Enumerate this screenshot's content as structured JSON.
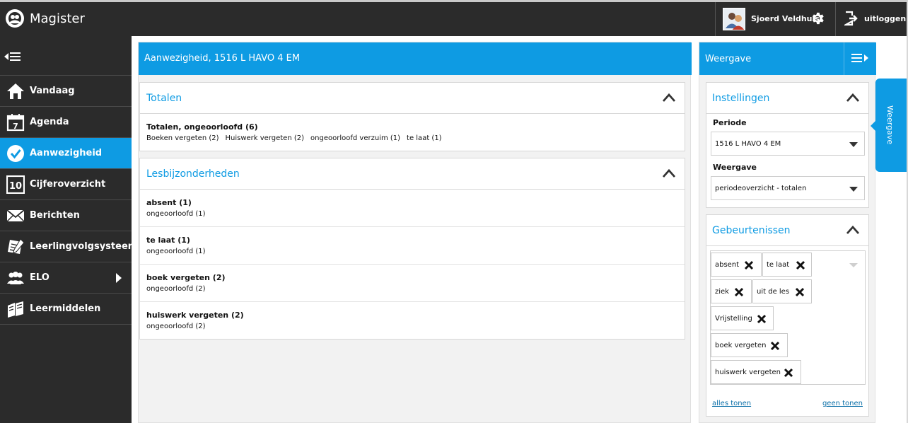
{
  "app": {
    "name": "Magister"
  },
  "user": {
    "name": "Sjoerd Veldhuis",
    "logout_label": "uitloggen"
  },
  "sidebar": {
    "items": [
      {
        "label": "Vandaag",
        "icon": "home-icon"
      },
      {
        "label": "Agenda",
        "icon": "calendar-icon"
      },
      {
        "label": "Aanwezigheid",
        "icon": "check-circle-icon",
        "active": true
      },
      {
        "label": "Cijferoverzicht",
        "icon": "grade-10-icon"
      },
      {
        "label": "Berichten",
        "icon": "envelope-icon"
      },
      {
        "label": "Leerlingvolgsysteem",
        "icon": "notes-icon"
      },
      {
        "label": "ELO",
        "icon": "people-icon",
        "has_submenu": true
      },
      {
        "label": "Leermiddelen",
        "icon": "books-icon"
      }
    ]
  },
  "main": {
    "title": "Aanwezigheid, 1516 L HAVO 4 EM",
    "totals": {
      "title": "Totalen",
      "heading": "Totalen, ongeoorloofd (6)",
      "items": [
        "Boeken vergeten (2)",
        "Huiswerk vergeten (2)",
        "ongeoorloofd verzuim (1)",
        "te laat (1)"
      ]
    },
    "details": {
      "title": "Lesbijzonderheden",
      "rows": [
        {
          "title": "absent (1)",
          "sub": "ongeoorloofd (1)"
        },
        {
          "title": "te laat (1)",
          "sub": "ongeoorloofd (1)"
        },
        {
          "title": "boek vergeten (2)",
          "sub": "ongeoorloofd (2)"
        },
        {
          "title": "huiswerk vergeten (2)",
          "sub": "ongeoorloofd (2)"
        }
      ]
    }
  },
  "rpanel": {
    "title": "Weergave",
    "settings": {
      "title": "Instellingen",
      "periode_label": "Periode",
      "periode_value": "1516 L HAVO 4 EM",
      "weergave_label": "Weergave",
      "weergave_value": "periodeoverzicht - totalen"
    },
    "events": {
      "title": "Gebeurtenissen",
      "tags": [
        "absent",
        "te laat",
        "ziek",
        "uit de les",
        "Vrijstelling",
        "boek vergeten",
        "huiswerk vergeten"
      ],
      "show_all": "alles tonen",
      "show_none": "geen tonen"
    }
  },
  "side_tab": {
    "label": "Weergave"
  },
  "colors": {
    "accent": "#0e9be3",
    "dark": "#2b2b2b"
  }
}
